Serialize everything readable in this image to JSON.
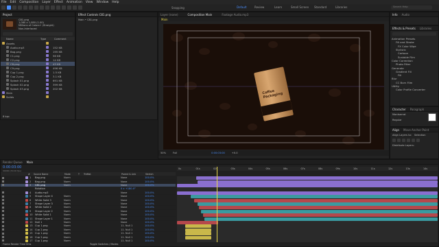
{
  "menu": [
    "File",
    "Edit",
    "Composition",
    "Layer",
    "Effect",
    "Animation",
    "View",
    "Window",
    "Help"
  ],
  "toolbar": {
    "snapping": "Snapping"
  },
  "workspaces": {
    "items": [
      "Default",
      "Review",
      "Learn",
      "Small Screen",
      "Standard",
      "Libraries"
    ],
    "active": "Default",
    "search": "Search Help"
  },
  "project": {
    "tab": "Project",
    "file_name": "C81.png",
    "file_info": "1,080 x 1,080 (1.00)",
    "file_info2": "Millions of Colors+ (Straight)",
    "file_info3": "Non-Interlaced",
    "columns": [
      "Name",
      "Type",
      "Comment"
    ],
    "items": [
      {
        "name": "Assets",
        "size": "",
        "folder": true
      },
      {
        "name": "Audio.mp3",
        "size": "152 KB"
      },
      {
        "name": "Bag.png",
        "size": "195 KB"
      },
      {
        "name": "C1.png",
        "size": "56 KB"
      },
      {
        "name": "C2.png",
        "size": "14 KB"
      },
      {
        "name": "C8.png",
        "size": "43 KB",
        "selected": true
      },
      {
        "name": "C9.png",
        "size": "496 KB"
      },
      {
        "name": "Cup 1.png",
        "size": "1.5 KB"
      },
      {
        "name": "Cup 2.png",
        "size": "3.1 KB"
      },
      {
        "name": "Splash 01.png",
        "size": "691 KB"
      },
      {
        "name": "Splash 02.png",
        "size": "399 KB"
      },
      {
        "name": "Splash 03.png",
        "size": "202 KB"
      },
      {
        "name": "Main",
        "size": "",
        "comp": true
      },
      {
        "name": "Solids",
        "size": "",
        "folder": true
      }
    ],
    "bpc": "8 bpc"
  },
  "effect_controls": {
    "tab": "Effect Controls C81.png",
    "path": "Main • C81.png"
  },
  "viewer": {
    "tabs": [
      "Layer (none)",
      "Composition Main",
      "Footage Audio.mp3"
    ],
    "comp_tab": "Main",
    "bag_text": "Coffee Packaging",
    "zoom": "50%",
    "quality": "Full",
    "timecode": "0:00:03:00",
    "exposure": "+0.0"
  },
  "right": {
    "info_tab": "Info",
    "audio_tab": "Audio",
    "effects_tab": "Effects & Presets",
    "libraries_tab": "Libraries",
    "effects": [
      "Animation Presets",
      "Fill and Stroke",
      "FX Color Wipe",
      "Stylistic",
      "Cartoon",
      "Scalable Film",
      "Color Correction",
      "Photo Filter",
      "Generate",
      "Gradient Fill",
      "Fill",
      "Blur",
      "CC Burn Film",
      "Utility",
      "Color Profile Converter"
    ],
    "character_tab": "Character",
    "paragraph_tab": "Paragraph",
    "font": "Montserrat",
    "font_style": "Regular",
    "align_tab": "Align",
    "anchor_tab": "Move Anchor Point",
    "align_to": "Align Layers to:",
    "selection": "Selection",
    "distribute": "Distribute Layers:"
  },
  "timeline": {
    "tabs": [
      "Render Queue",
      "Main"
    ],
    "timecode": "0:00:03:00",
    "fps": "00090 (30.00 fps)",
    "columns": [
      "#",
      "Source Name",
      "Mode",
      "T",
      "TrkMat",
      "Parent & Link",
      "Stretch"
    ],
    "ruler": [
      "0s",
      "01s",
      "02s",
      "03s",
      "04s",
      "05s",
      "06s",
      "07s",
      "08s",
      "09s",
      "10s",
      "11s",
      "12s",
      "13s",
      "14s"
    ],
    "footer": "Frame Render Time  0ms",
    "toggle": "Toggle Switches / Modes",
    "layers": [
      {
        "num": "1",
        "name": "Bag.png",
        "color": "#a28ed6",
        "mode": "Norm",
        "parent": "None",
        "stretch": "100.0%"
      },
      {
        "num": "2",
        "name": "Bag.png",
        "color": "#a28ed6",
        "mode": "Norm",
        "parent": "None",
        "stretch": "100.0%"
      },
      {
        "num": "3",
        "name": "C81.png",
        "color": "#a28ed6",
        "mode": "Norm",
        "parent": "None",
        "stretch": "100.0%",
        "selected": true
      },
      {
        "num": "",
        "name": "Rotation",
        "color": "",
        "mode": "",
        "parent": "0 x +180.0°",
        "stretch": ""
      },
      {
        "num": "4",
        "name": "Audio.mp3",
        "color": "#a28ed6",
        "mode": "",
        "parent": "None",
        "stretch": "100.0%"
      },
      {
        "num": "5",
        "name": "Shape Layer 4",
        "color": "#3e7fa8",
        "mode": "Norm",
        "parent": "None",
        "stretch": "100.0%"
      },
      {
        "num": "6",
        "name": "White Solid 3",
        "color": "#c44a4a",
        "mode": "Norm",
        "parent": "None",
        "stretch": "100.0%"
      },
      {
        "num": "7",
        "name": "Shape Layer 3",
        "color": "#3e7fa8",
        "mode": "Norm",
        "parent": "None",
        "stretch": "100.0%"
      },
      {
        "num": "8",
        "name": "White Solid 2",
        "color": "#c44a4a",
        "mode": "Norm",
        "parent": "None",
        "stretch": "100.0%"
      },
      {
        "num": "9",
        "name": "Shape Layer 2",
        "color": "#3e7fa8",
        "mode": "Norm",
        "parent": "None",
        "stretch": "100.0%"
      },
      {
        "num": "10",
        "name": "White Solid 1",
        "color": "#c44a4a",
        "mode": "Norm",
        "parent": "None",
        "stretch": "100.0%"
      },
      {
        "num": "11",
        "name": "Shape Layer 1",
        "color": "#3e7fa8",
        "mode": "Norm",
        "parent": "None",
        "stretch": "100.0%"
      },
      {
        "num": "12",
        "name": "Null 1",
        "color": "#c44a4a",
        "mode": "Norm",
        "parent": "None",
        "stretch": "100.0%"
      },
      {
        "num": "13",
        "name": "Cup 1.png",
        "color": "#d6c24a",
        "mode": "Norm",
        "parent": "11. Null 1",
        "stretch": "100.0%"
      },
      {
        "num": "14",
        "name": "Cup 2.png",
        "color": "#d6c24a",
        "mode": "Norm",
        "parent": "11. Null 1",
        "stretch": "100.0%"
      },
      {
        "num": "15",
        "name": "Cup 1.png",
        "color": "#d6c24a",
        "mode": "Norm",
        "parent": "11. Null 1",
        "stretch": "100.0%"
      },
      {
        "num": "16",
        "name": "Cup 2.png",
        "color": "#d6c24a",
        "mode": "Norm",
        "parent": "11. Null 1",
        "stretch": "100.0%"
      },
      {
        "num": "17",
        "name": "Cup 1.png",
        "color": "#d6c24a",
        "mode": "Norm",
        "parent": "11. Null 1",
        "stretch": "100.0%"
      }
    ]
  },
  "colors": {
    "accent": "#4a8df8",
    "playhead": "#e9d84a",
    "purple": "#8a6fd0",
    "teal": "#3b9aa0",
    "red": "#b5484c",
    "yellow": "#c9b84a",
    "brown_bg": "#1a0e08"
  }
}
